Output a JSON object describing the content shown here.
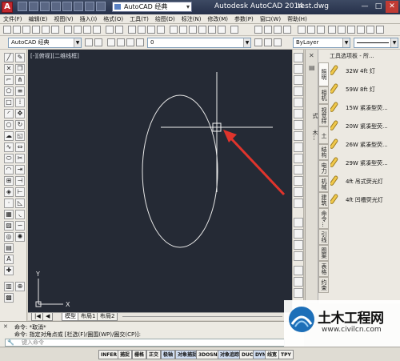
{
  "titlebar": {
    "workspace": "AutoCAD 经典",
    "app_title": "Autodesk AutoCAD 2014",
    "filename": "test.dwg",
    "min": "—",
    "max": "□",
    "close": "✕"
  },
  "menu": [
    "文件(F)",
    "编辑(E)",
    "视图(V)",
    "插入(I)",
    "格式(O)",
    "工具(T)",
    "绘图(D)",
    "标注(N)",
    "修改(M)",
    "参数(P)",
    "窗口(W)",
    "帮助(H)"
  ],
  "toolbar2": {
    "workspace_combo": "AutoCAD 经典",
    "layer_combo": "0",
    "bylayer_combo": "ByLayer"
  },
  "viewport": {
    "label": "[-][俯视][二维线框]"
  },
  "axes": {
    "y": "Y",
    "x": "X"
  },
  "layout_tabs": [
    "模型",
    "布局1",
    "布局2"
  ],
  "palette": {
    "title": "工具选项板 - 所...",
    "side_title": "工具选项板",
    "tabs": [
      "照明",
      "相机",
      "视觉样式",
      "土木...",
      "结构",
      "电力",
      "机械",
      "建筑",
      "命令...",
      "引线",
      "图案",
      "表格",
      "约束"
    ],
    "items": [
      {
        "label": "32W 4ft 灯"
      },
      {
        "label": "59W 8ft 灯"
      },
      {
        "label": "15W 紧凑型荧..."
      },
      {
        "label": "20W 紧凑型荧..."
      },
      {
        "label": "26W 紧凑型荧..."
      },
      {
        "label": "29W 紧凑型荧..."
      },
      {
        "label": "4ft 吊式荧光灯"
      },
      {
        "label": "4ft 凹槽荧光灯"
      }
    ]
  },
  "command": {
    "line1": "命令: *取消*",
    "line2": "命令: 指定对角点或 [栏选(F)/圈围(WP)/圈交(CP)]:",
    "placeholder": "键入命令"
  },
  "status": [
    "INFER",
    "捕捉",
    "栅格",
    "正交",
    "极轴",
    "对象捕捉",
    "3DOSNAP",
    "对象追踪",
    "DUCS",
    "DYN",
    "线宽",
    "TPY"
  ],
  "watermark": {
    "brand": "土木工程网",
    "url": "www.civilcn.com"
  },
  "colors": {
    "canvas": "#252a35",
    "arrow": "#e0342c"
  }
}
